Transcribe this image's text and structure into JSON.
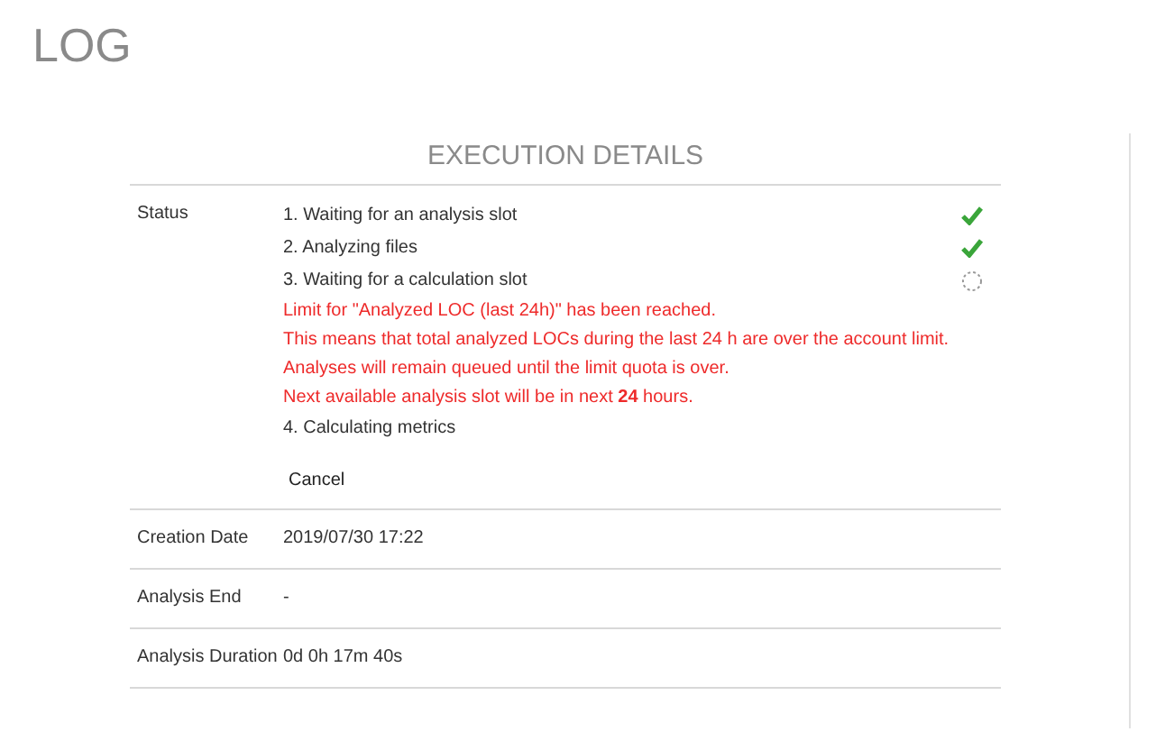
{
  "page_title": "LOG",
  "section_title": "EXECUTION DETAILS",
  "status": {
    "label": "Status",
    "steps": [
      {
        "text": "1. Waiting for an analysis slot",
        "kind": "done"
      },
      {
        "text": "2. Analyzing files",
        "kind": "done"
      },
      {
        "text": "3. Waiting for a calculation slot",
        "kind": "waiting",
        "messages": [
          "Limit for \"Analyzed LOC (last 24h)\" has been reached.",
          "This means that total analyzed LOCs during the last 24 h are over the account limit.",
          "Analyses will remain queued until the limit quota is over.",
          "Next available analysis slot will be in next **24** hours."
        ]
      },
      {
        "text": "4. Calculating metrics",
        "kind": "pending"
      }
    ],
    "cancel_button": "Cancel"
  },
  "details": [
    {
      "label": "Creation Date",
      "value": "2019/07/30 17:22"
    },
    {
      "label": "Analysis End",
      "value": "-"
    },
    {
      "label": "Analysis Duration",
      "value": "0d 0h 17m 40s"
    }
  ]
}
